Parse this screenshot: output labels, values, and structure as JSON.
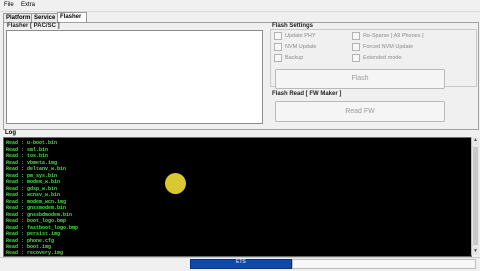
{
  "menubar": {
    "file": "File",
    "extra": "Extra"
  },
  "tabs": [
    {
      "label": "Platform"
    },
    {
      "label": "Service"
    },
    {
      "label": "Flasher"
    }
  ],
  "flasher": {
    "group_title": "Flasher [ PAC/SC ]",
    "settings_title": "Flash Settings",
    "options": {
      "update_phy": "Update PHY",
      "re_sparse": "Re-Sparse [ A9 Phones ]",
      "nvm_update": "NVM Update",
      "forced_nvm_update": "Forced NVM Update",
      "backup": "Backup",
      "extended_mode": "Extended mode"
    },
    "flash_button": "Flash",
    "flash_read_title": "Flash Read [ FW Maker ]",
    "read_fw_button": "Read FW"
  },
  "log": {
    "title": "Log",
    "lines": [
      "Read : u-boot.bin",
      "Read : sml.bin",
      "Read : tos.bin",
      "Read : vbmeta.img",
      "Read : deltanv_w.bin",
      "Read : pm_sys.bin",
      "Read : modem_w.bin",
      "Read : gdsp_w.bin",
      "Read : wcnsv_w.bin",
      "Read : modem_wcn.img",
      "Read : gnssmodem.bin",
      "Read : gnssbdmodem.bin",
      "Read : boot_logo.bmp",
      "Read : fastboot_logo.bmp",
      "Read : persist.img",
      "Read : phone.cfg",
      "Read : boot.img",
      "Read : recovery.img"
    ]
  },
  "status": {
    "text": "ETS"
  }
}
